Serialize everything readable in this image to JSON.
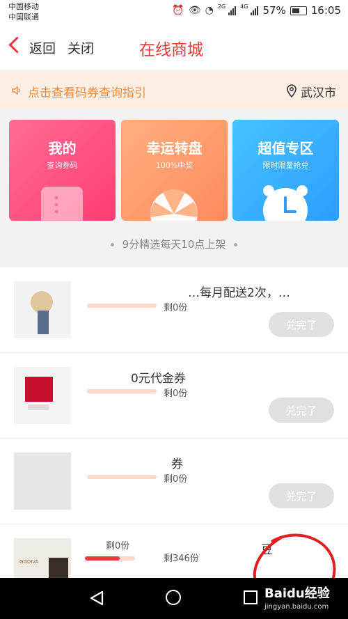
{
  "status_bar": {
    "carrier1": "中国移动",
    "carrier2": "中国联通",
    "net1": "2G",
    "net2": "4G",
    "battery": "57%",
    "time": "16:05"
  },
  "nav": {
    "back": "返回",
    "close": "关闭",
    "title": "在线商城"
  },
  "notice": {
    "text": "点击查看码券查询指引",
    "city": "武汉市"
  },
  "cards": [
    {
      "title": "我的",
      "subtitle": "查询券码",
      "color": "#ff4f80"
    },
    {
      "title": "幸运转盘",
      "subtitle": "100%中奖",
      "color": "#ff9a6a"
    },
    {
      "title": "超值专区",
      "subtitle": "限时限量抢兑",
      "color": "#38aefc"
    }
  ],
  "tagline": "9分精选每天10点上架",
  "products": [
    {
      "title": "…每月配送2次，…",
      "remaining": "剩0份",
      "progress": 0,
      "button": "兑完了"
    },
    {
      "title": "0元代金券",
      "remaining": "剩0份",
      "progress": 0,
      "button": "兑完了"
    },
    {
      "title": "券",
      "remaining": "剩0份",
      "progress": 0,
      "button": "兑完了"
    },
    {
      "title": "豆",
      "remaining_a": "剩0份",
      "remaining_b": "剩346份",
      "progress": 0.7
    }
  ],
  "watermark": {
    "brand": "Baidu经验",
    "url": "jingyan.baidu.com"
  },
  "colors": {
    "accent": "#e8393b",
    "notice_bg": "#fdeee3",
    "notice_text": "#e88a3e"
  }
}
